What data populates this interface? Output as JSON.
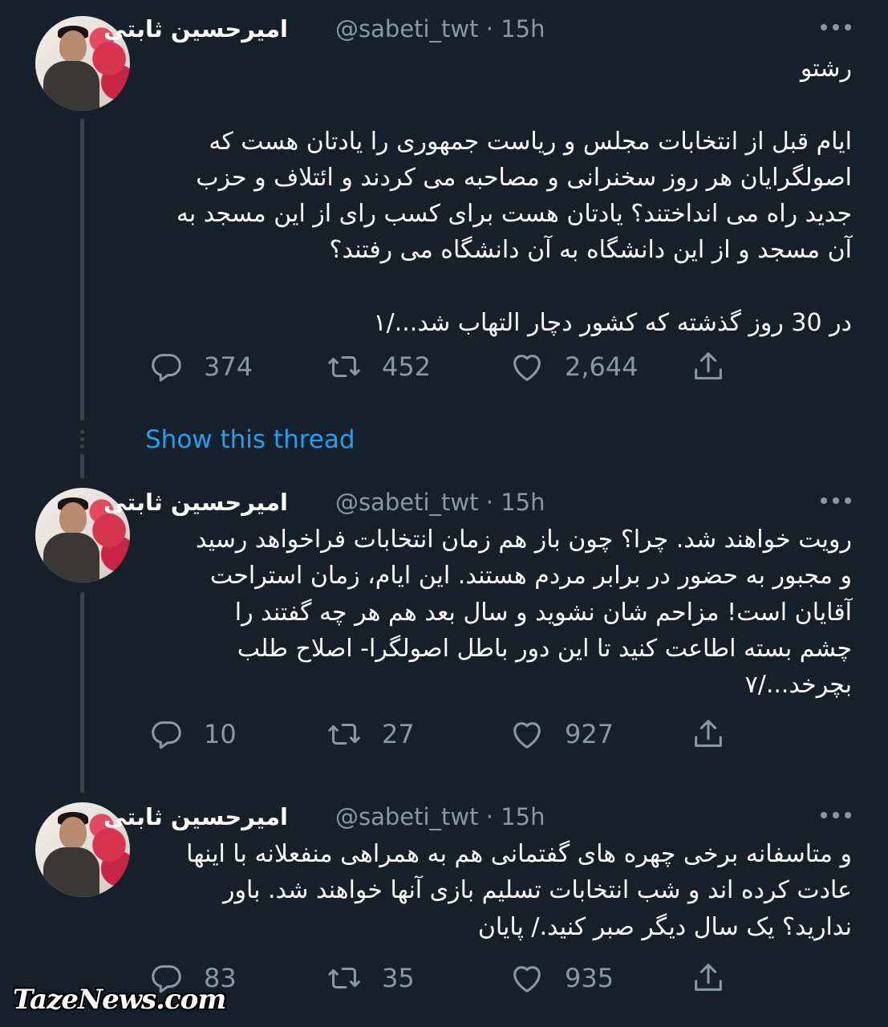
{
  "author": {
    "name": "امیرحسین ثابتی",
    "handle": "@sabeti_twt",
    "separator": "·",
    "time": "15h"
  },
  "tweets": [
    {
      "text": "رشتو\n\nایام قبل از انتخابات مجلس و ریاست جمهوری را یادتان هست که\nاصولگرایان هر روز سخنرانی و مصاحبه می کردند و ائتلاف و حزب\nجدید راه می انداختند؟ یادتان هست برای کسب رای از این مسجد به\nآن مسجد و از این دانشگاه به آن دانشگاه می رفتند؟\n\nدر 30 روز گذشته که کشور دچار التهاب شد.../۱",
      "replies": "374",
      "retweets": "452",
      "likes": "2,644"
    },
    {
      "text": "رویت خواهند شد. چرا؟ چون باز هم زمان انتخابات فراخواهد رسید\nو مجبور به حضور در برابر مردم هستند. این ایام، زمان استراحت\nآقایان است! مزاحم شان نشوید و سال بعد هم هر چه گفتند را\nچشم بسته اطاعت کنید تا این دور باطل اصولگرا- اصلاح طلب\nبچرخد.../۷",
      "replies": "10",
      "retweets": "27",
      "likes": "927"
    },
    {
      "text": "و متاسفانه برخی چهره های گفتمانی هم به همراهی منفعلانه با اینها\nعادت کرده اند و شب انتخابات تسلیم بازی آنها خواهند شد. باور\nندارید؟ یک سال دیگر صبر کنید./ پایان",
      "replies": "83",
      "retweets": "35",
      "likes": "935"
    }
  ],
  "show_thread_label": "Show this thread",
  "watermark": "TazeNews.com",
  "colors": {
    "background": "#15202b",
    "secondary_text": "#8899a6",
    "link": "#1da1f2",
    "thread_line": "#38444d"
  },
  "icons": [
    "reply-icon",
    "retweet-icon",
    "like-icon",
    "share-icon",
    "more-icon"
  ]
}
